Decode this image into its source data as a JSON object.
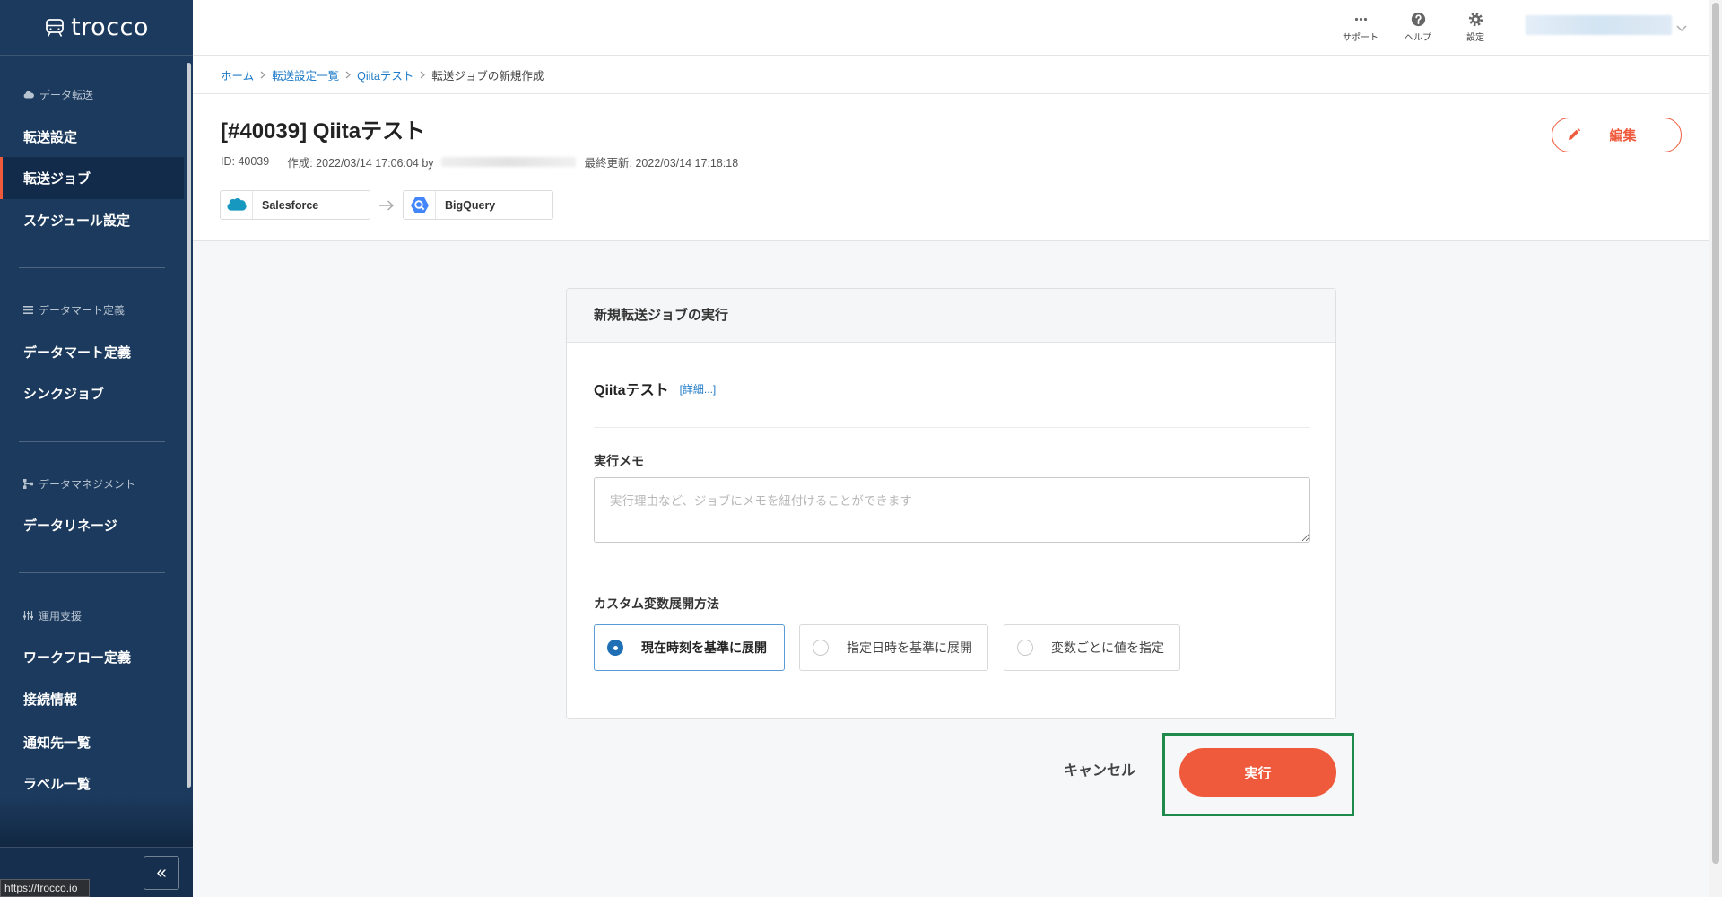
{
  "app": {
    "logo_text": "trocco",
    "logo_icon": "train-icon"
  },
  "colors": {
    "sidebar_bg": "#1b3a5d",
    "sidebar_active_bg": "#132b4a",
    "accent": "#ef5a3c",
    "link": "#1f7bc8",
    "radio_selected": "#1f6fb5",
    "highlight_border": "#1e8b4c"
  },
  "sidebar": {
    "sections": [
      {
        "header": "データ転送",
        "icon": "cloud-icon",
        "items": [
          {
            "label": "転送設定"
          },
          {
            "label": "転送ジョブ",
            "active": true
          },
          {
            "label": "スケジュール設定"
          }
        ]
      },
      {
        "header": "データマート定義",
        "icon": "list-icon",
        "items": [
          {
            "label": "データマート定義"
          },
          {
            "label": "シンクジョブ"
          }
        ]
      },
      {
        "header": "データマネジメント",
        "icon": "lineage-icon",
        "items": [
          {
            "label": "データリネージ"
          }
        ]
      },
      {
        "header": "運用支援",
        "icon": "sliders-icon",
        "items": [
          {
            "label": "ワークフロー定義"
          },
          {
            "label": "接続情報"
          },
          {
            "label": "通知先一覧"
          },
          {
            "label": "ラベル一覧"
          }
        ]
      }
    ],
    "collapse_label": "«"
  },
  "header": {
    "support": {
      "label": "サポート",
      "icon": "more-icon"
    },
    "help": {
      "label": "ヘルプ",
      "icon": "help-icon"
    },
    "settings": {
      "label": "設定",
      "icon": "gear-icon"
    },
    "user_menu_icon": "chevron-down-icon"
  },
  "breadcrumb": [
    {
      "label": "ホーム",
      "link": true
    },
    {
      "label": "転送設定一覧",
      "link": true
    },
    {
      "label": "Qiitaテスト",
      "link": true
    },
    {
      "label": "転送ジョブの新規作成",
      "link": false
    }
  ],
  "job": {
    "title": "[#40039] Qiitaテスト",
    "id": "ID: 40039",
    "created": "作成: 2022/03/14 17:06:04 by",
    "updated": "最終更新: 2022/03/14 17:18:18",
    "source": {
      "name": "Salesforce",
      "icon": "salesforce-icon"
    },
    "destination": {
      "name": "BigQuery",
      "icon": "bigquery-icon"
    },
    "edit_label": "編集",
    "edit_icon": "pencil-icon"
  },
  "run_form": {
    "title": "新規転送ジョブの実行",
    "job_name": "Qiitaテスト",
    "detail_link": "[詳細...]",
    "memo_label": "実行メモ",
    "memo_placeholder": "実行理由など、ジョブにメモを紐付けることができます",
    "custom_var_label": "カスタム変数展開方法",
    "custom_var_options": [
      {
        "label": "現在時刻を基準に展開",
        "selected": true
      },
      {
        "label": "指定日時を基準に展開",
        "selected": false
      },
      {
        "label": "変数ごとに値を指定",
        "selected": false
      }
    ],
    "cancel_label": "キャンセル",
    "execute_label": "実行"
  },
  "status_bar": {
    "url": "https://trocco.io"
  }
}
